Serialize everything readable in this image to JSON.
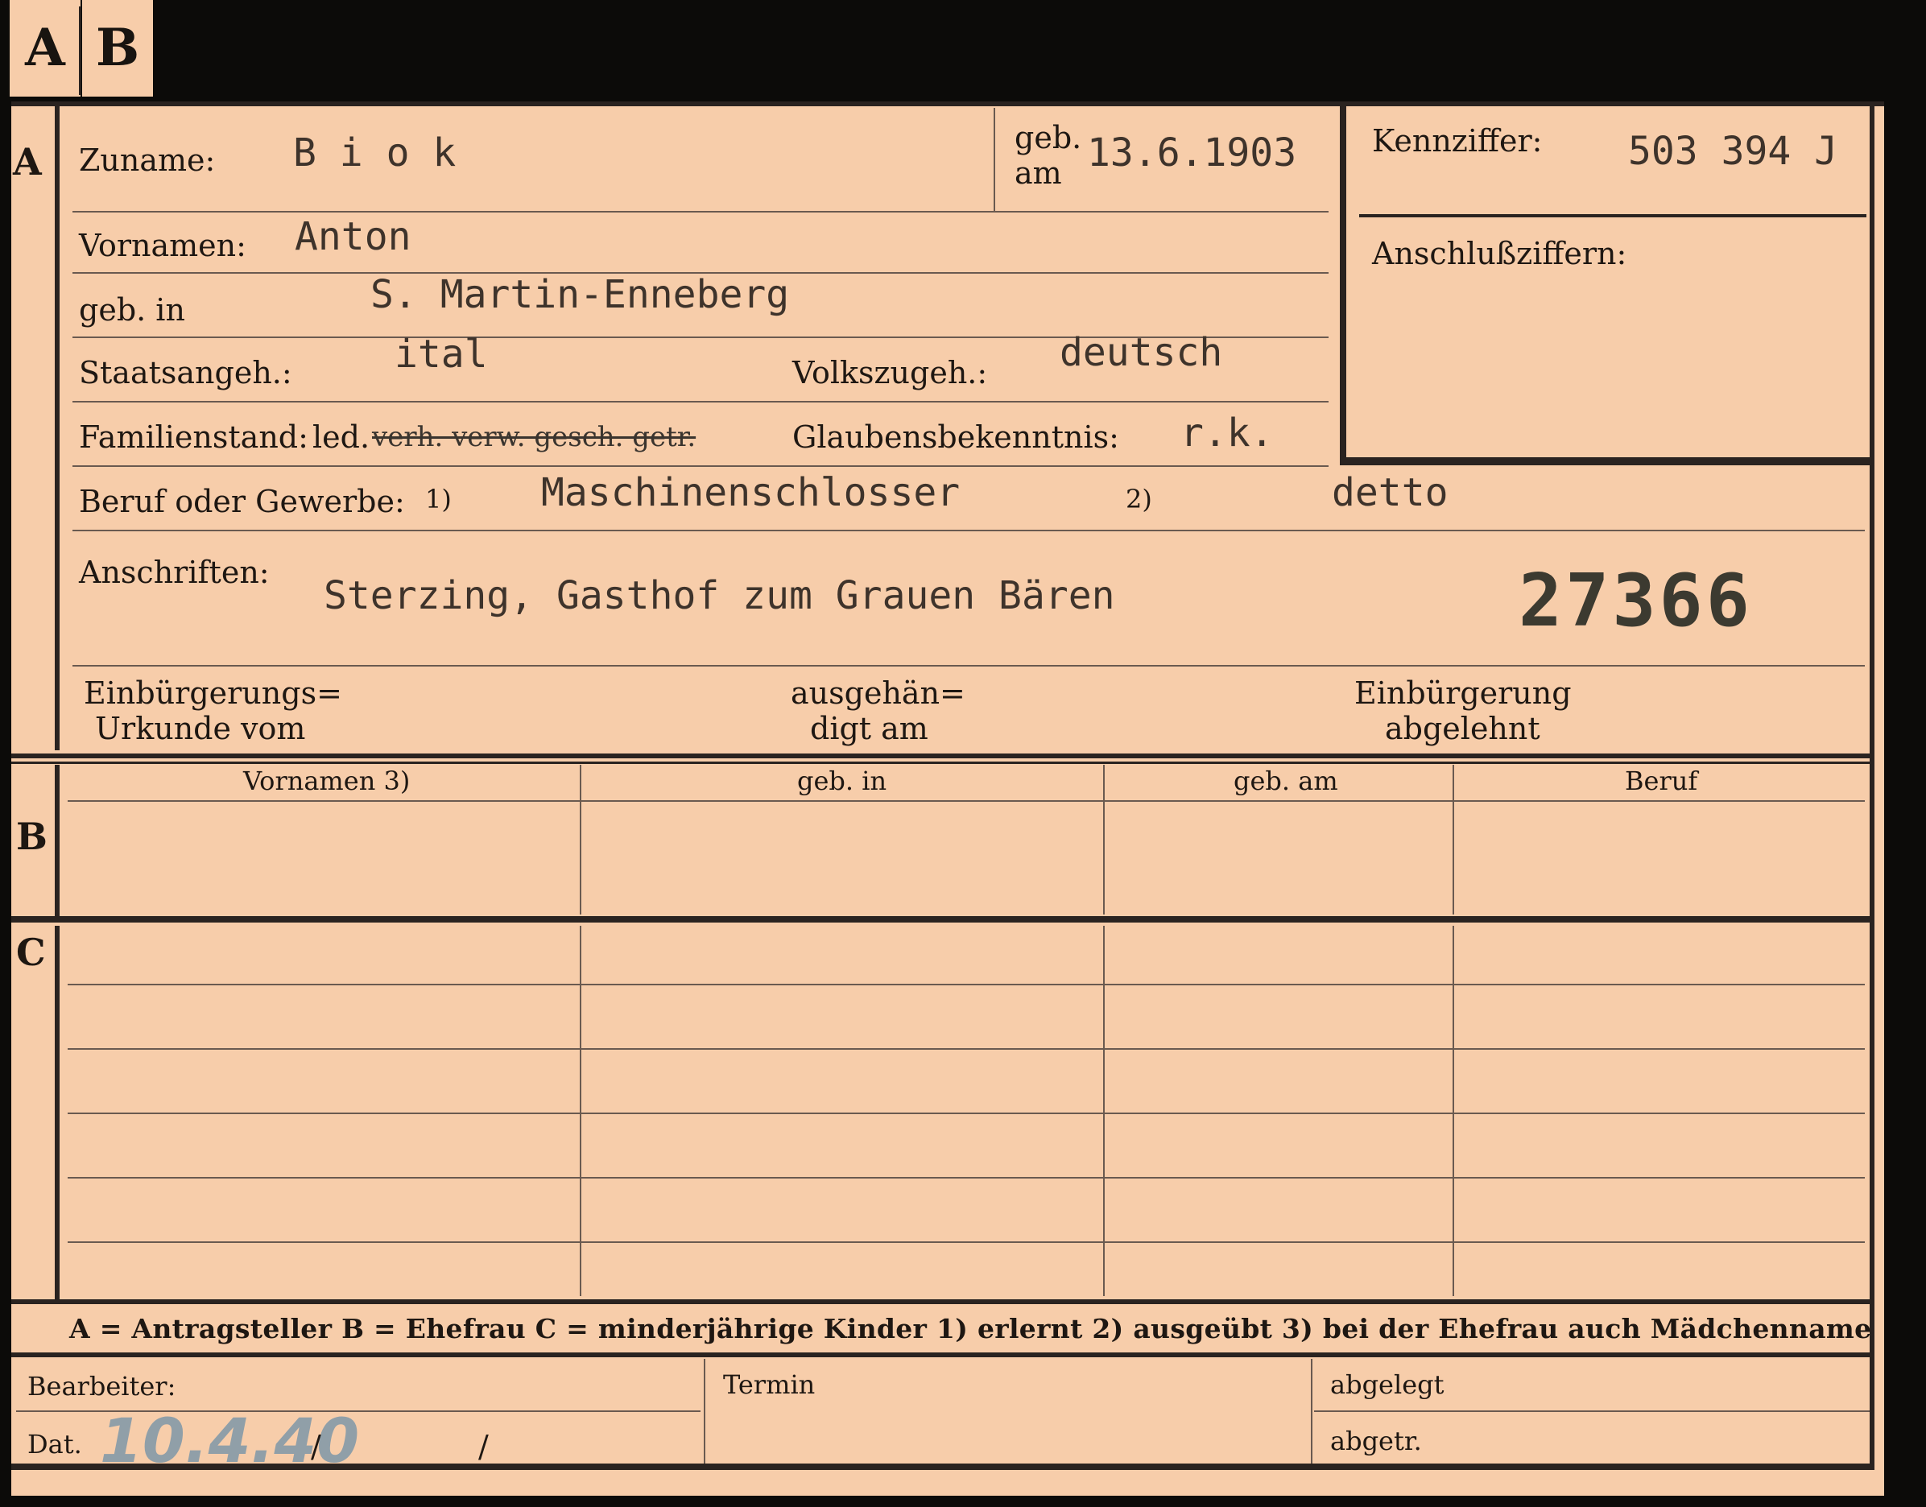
{
  "tabs": [
    "A",
    "B"
  ],
  "section_markers": {
    "a": "A",
    "b": "B",
    "c": "C"
  },
  "section_a": {
    "surname_label": "Zuname:",
    "surname_value": "B i o k",
    "birthdate_label_1": "geb.",
    "birthdate_label_2": "am",
    "birthdate_value": "13.6.1903",
    "firstnames_label": "Vornamen:",
    "firstnames_value": "Anton",
    "birthplace_label": "geb. in",
    "birthplace_value": "S. Martin-Enneberg",
    "citizenship_label": "Staatsangeh.:",
    "citizenship_value": "ital",
    "ethnicity_label": "Volkszugeh.:",
    "ethnicity_value": "deutsch",
    "marital_label": "Familienstand:",
    "marital_value": "led.",
    "marital_struck": "verh. verw. gesch. getr.",
    "religion_label": "Glaubensbekenntnis:",
    "religion_value": "r.k.",
    "occupation_label": "Beruf oder Gewerbe:",
    "occupation_mark_1": "1)",
    "occupation_value_1": "Maschinenschlosser",
    "occupation_mark_2": "2)",
    "occupation_value_2": "detto",
    "address_label": "Anschriften:",
    "address_value": "Sterzing, Gasthof zum Grauen Bären",
    "stamp_number": "27366",
    "id_label": "Kennziffer:",
    "id_value": "503 394 J",
    "linked_label": "Anschlußziffern:",
    "naturalization_label_1": "Einbürgerungs=",
    "naturalization_label_2": "Urkunde vom",
    "handed_label_1": "ausgehän=",
    "handed_label_2": "digt am",
    "refused_label_1": "Einbürgerung",
    "refused_label_2": "abgelehnt"
  },
  "table_headers": [
    "Vornamen 3)",
    "geb. in",
    "geb. am",
    "Beruf"
  ],
  "legend": "A = Antragsteller   B = Ehefrau   C = minderjährige Kinder   1) erlernt   2) ausgeübt   3) bei der Ehefrau auch Mädchenname",
  "footer": {
    "clerk_label": "Bearbeiter:",
    "date_label": "Dat.",
    "date_value": "10.4.40",
    "slash_1": "/",
    "slash_2": "/",
    "deadline_label": "Termin",
    "filed_label": "abgelegt",
    "removed_label": "abgetr."
  },
  "colors": {
    "card": "#f7cdaa",
    "background": "#0c0b09",
    "ink": "#1e1712",
    "pencil": "#7f98a8"
  }
}
